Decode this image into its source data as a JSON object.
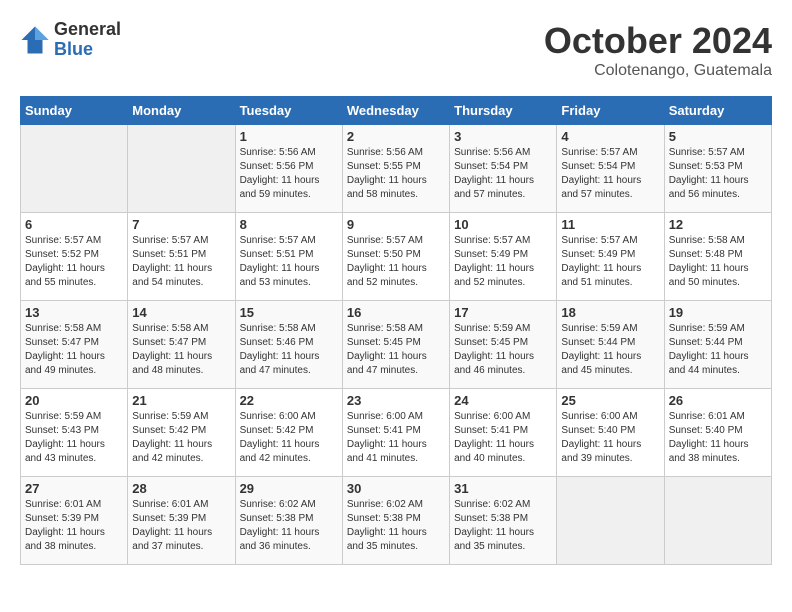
{
  "logo": {
    "general": "General",
    "blue": "Blue"
  },
  "title": "October 2024",
  "location": "Colotenango, Guatemala",
  "headers": [
    "Sunday",
    "Monday",
    "Tuesday",
    "Wednesday",
    "Thursday",
    "Friday",
    "Saturday"
  ],
  "weeks": [
    [
      {
        "day": "",
        "sunrise": "",
        "sunset": "",
        "daylight": ""
      },
      {
        "day": "",
        "sunrise": "",
        "sunset": "",
        "daylight": ""
      },
      {
        "day": "1",
        "sunrise": "Sunrise: 5:56 AM",
        "sunset": "Sunset: 5:56 PM",
        "daylight": "Daylight: 11 hours and 59 minutes."
      },
      {
        "day": "2",
        "sunrise": "Sunrise: 5:56 AM",
        "sunset": "Sunset: 5:55 PM",
        "daylight": "Daylight: 11 hours and 58 minutes."
      },
      {
        "day": "3",
        "sunrise": "Sunrise: 5:56 AM",
        "sunset": "Sunset: 5:54 PM",
        "daylight": "Daylight: 11 hours and 57 minutes."
      },
      {
        "day": "4",
        "sunrise": "Sunrise: 5:57 AM",
        "sunset": "Sunset: 5:54 PM",
        "daylight": "Daylight: 11 hours and 57 minutes."
      },
      {
        "day": "5",
        "sunrise": "Sunrise: 5:57 AM",
        "sunset": "Sunset: 5:53 PM",
        "daylight": "Daylight: 11 hours and 56 minutes."
      }
    ],
    [
      {
        "day": "6",
        "sunrise": "Sunrise: 5:57 AM",
        "sunset": "Sunset: 5:52 PM",
        "daylight": "Daylight: 11 hours and 55 minutes."
      },
      {
        "day": "7",
        "sunrise": "Sunrise: 5:57 AM",
        "sunset": "Sunset: 5:51 PM",
        "daylight": "Daylight: 11 hours and 54 minutes."
      },
      {
        "day": "8",
        "sunrise": "Sunrise: 5:57 AM",
        "sunset": "Sunset: 5:51 PM",
        "daylight": "Daylight: 11 hours and 53 minutes."
      },
      {
        "day": "9",
        "sunrise": "Sunrise: 5:57 AM",
        "sunset": "Sunset: 5:50 PM",
        "daylight": "Daylight: 11 hours and 52 minutes."
      },
      {
        "day": "10",
        "sunrise": "Sunrise: 5:57 AM",
        "sunset": "Sunset: 5:49 PM",
        "daylight": "Daylight: 11 hours and 52 minutes."
      },
      {
        "day": "11",
        "sunrise": "Sunrise: 5:57 AM",
        "sunset": "Sunset: 5:49 PM",
        "daylight": "Daylight: 11 hours and 51 minutes."
      },
      {
        "day": "12",
        "sunrise": "Sunrise: 5:58 AM",
        "sunset": "Sunset: 5:48 PM",
        "daylight": "Daylight: 11 hours and 50 minutes."
      }
    ],
    [
      {
        "day": "13",
        "sunrise": "Sunrise: 5:58 AM",
        "sunset": "Sunset: 5:47 PM",
        "daylight": "Daylight: 11 hours and 49 minutes."
      },
      {
        "day": "14",
        "sunrise": "Sunrise: 5:58 AM",
        "sunset": "Sunset: 5:47 PM",
        "daylight": "Daylight: 11 hours and 48 minutes."
      },
      {
        "day": "15",
        "sunrise": "Sunrise: 5:58 AM",
        "sunset": "Sunset: 5:46 PM",
        "daylight": "Daylight: 11 hours and 47 minutes."
      },
      {
        "day": "16",
        "sunrise": "Sunrise: 5:58 AM",
        "sunset": "Sunset: 5:45 PM",
        "daylight": "Daylight: 11 hours and 47 minutes."
      },
      {
        "day": "17",
        "sunrise": "Sunrise: 5:59 AM",
        "sunset": "Sunset: 5:45 PM",
        "daylight": "Daylight: 11 hours and 46 minutes."
      },
      {
        "day": "18",
        "sunrise": "Sunrise: 5:59 AM",
        "sunset": "Sunset: 5:44 PM",
        "daylight": "Daylight: 11 hours and 45 minutes."
      },
      {
        "day": "19",
        "sunrise": "Sunrise: 5:59 AM",
        "sunset": "Sunset: 5:44 PM",
        "daylight": "Daylight: 11 hours and 44 minutes."
      }
    ],
    [
      {
        "day": "20",
        "sunrise": "Sunrise: 5:59 AM",
        "sunset": "Sunset: 5:43 PM",
        "daylight": "Daylight: 11 hours and 43 minutes."
      },
      {
        "day": "21",
        "sunrise": "Sunrise: 5:59 AM",
        "sunset": "Sunset: 5:42 PM",
        "daylight": "Daylight: 11 hours and 42 minutes."
      },
      {
        "day": "22",
        "sunrise": "Sunrise: 6:00 AM",
        "sunset": "Sunset: 5:42 PM",
        "daylight": "Daylight: 11 hours and 42 minutes."
      },
      {
        "day": "23",
        "sunrise": "Sunrise: 6:00 AM",
        "sunset": "Sunset: 5:41 PM",
        "daylight": "Daylight: 11 hours and 41 minutes."
      },
      {
        "day": "24",
        "sunrise": "Sunrise: 6:00 AM",
        "sunset": "Sunset: 5:41 PM",
        "daylight": "Daylight: 11 hours and 40 minutes."
      },
      {
        "day": "25",
        "sunrise": "Sunrise: 6:00 AM",
        "sunset": "Sunset: 5:40 PM",
        "daylight": "Daylight: 11 hours and 39 minutes."
      },
      {
        "day": "26",
        "sunrise": "Sunrise: 6:01 AM",
        "sunset": "Sunset: 5:40 PM",
        "daylight": "Daylight: 11 hours and 38 minutes."
      }
    ],
    [
      {
        "day": "27",
        "sunrise": "Sunrise: 6:01 AM",
        "sunset": "Sunset: 5:39 PM",
        "daylight": "Daylight: 11 hours and 38 minutes."
      },
      {
        "day": "28",
        "sunrise": "Sunrise: 6:01 AM",
        "sunset": "Sunset: 5:39 PM",
        "daylight": "Daylight: 11 hours and 37 minutes."
      },
      {
        "day": "29",
        "sunrise": "Sunrise: 6:02 AM",
        "sunset": "Sunset: 5:38 PM",
        "daylight": "Daylight: 11 hours and 36 minutes."
      },
      {
        "day": "30",
        "sunrise": "Sunrise: 6:02 AM",
        "sunset": "Sunset: 5:38 PM",
        "daylight": "Daylight: 11 hours and 35 minutes."
      },
      {
        "day": "31",
        "sunrise": "Sunrise: 6:02 AM",
        "sunset": "Sunset: 5:38 PM",
        "daylight": "Daylight: 11 hours and 35 minutes."
      },
      {
        "day": "",
        "sunrise": "",
        "sunset": "",
        "daylight": ""
      },
      {
        "day": "",
        "sunrise": "",
        "sunset": "",
        "daylight": ""
      }
    ]
  ]
}
